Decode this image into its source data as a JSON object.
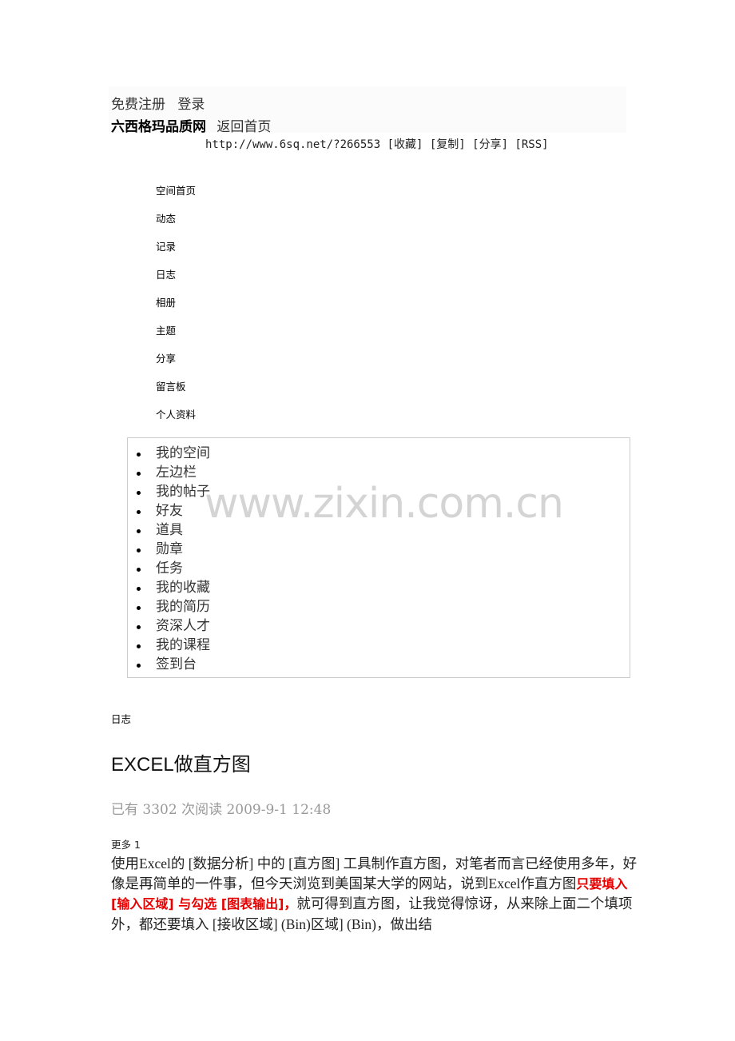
{
  "header": {
    "links": [
      "免费注册",
      "登录"
    ],
    "site_name": "六西格玛品质网",
    "back_home": "返回首页",
    "url_bar": "http://www.6sq.net/?266553 [收藏] [复制] [分享] [RSS]"
  },
  "nav": [
    "空间首页",
    "动态",
    "记录",
    "日志",
    "相册",
    "主题",
    "分享",
    "留言板",
    "个人资料"
  ],
  "sidebar": [
    "我的空间",
    "左边栏",
    "我的帖子",
    "好友",
    "道具",
    "勋章",
    "任务",
    "我的收藏",
    "我的简历",
    "资深人才",
    "我的课程",
    "签到台"
  ],
  "watermark": "www.zixin.com.cn",
  "section_label": "日志",
  "post": {
    "title": "EXCEL做直方图",
    "meta": "已有 3302 次阅读 2009-9-1 12:48",
    "more": "更多 1",
    "paragraph_a": "使用Excel的 [数据分析] 中的 [直方图] 工具制作直方图，对笔者而言已经使用多年，好像是再简单的一件事，但今天浏览到美国某大学的网站，说到Excel作直方图",
    "highlight": "只要填入 [输入区域] 与勾选 [图表输出]，",
    "paragraph_b": "就可得到直方图，让我觉得惊讶，从来除上面二个填项外，都还要填入 [接收区域] (Bin)区域] (Bin)，做出结"
  }
}
